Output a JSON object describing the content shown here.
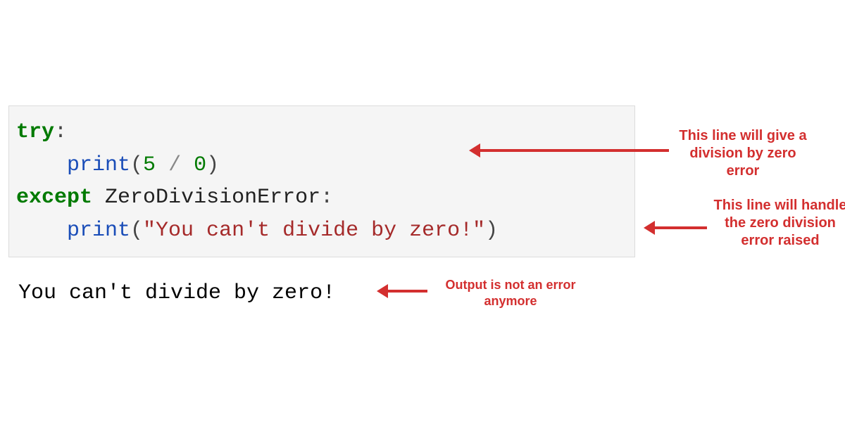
{
  "code": {
    "line1_kw": "try",
    "line1_colon": ":",
    "line2_fn": "print",
    "line2_open": "(",
    "line2_num1": "5",
    "line2_op": " / ",
    "line2_num2": "0",
    "line2_close": ")",
    "line3_kw": "except",
    "line3_sp": " ",
    "line3_cls": "ZeroDivisionError",
    "line3_colon": ":",
    "line4_fn": "print",
    "line4_open": "(",
    "line4_str": "\"You can't divide by zero!\"",
    "line4_close": ")"
  },
  "output": "You can't divide by zero!",
  "annotations": {
    "a1": "This line will give a division by zero error",
    "a2": "This line will handle the zero division error raised",
    "a3": "Output is not an error anymore"
  },
  "colors": {
    "annotation_red": "#d32f2f",
    "keyword_green": "#007a00",
    "function_blue": "#1a4db8",
    "string_brown": "#a52a2a"
  }
}
